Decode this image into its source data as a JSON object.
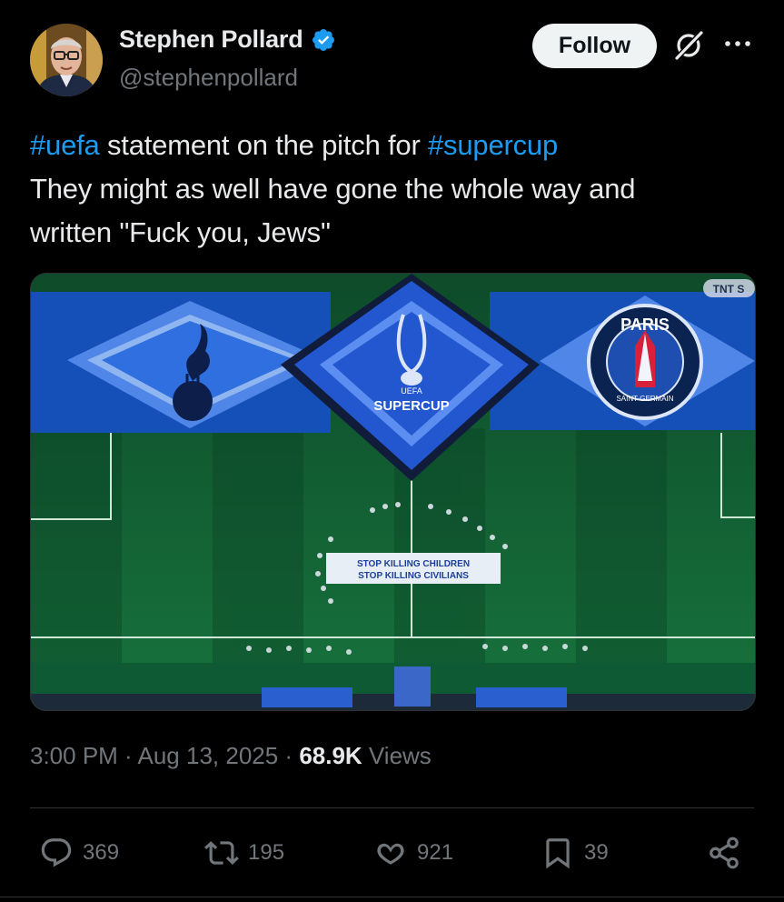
{
  "author": {
    "display_name": "Stephen Pollard",
    "handle": "@stephenpollard",
    "verified": true,
    "avatar_icon": "avatar-photo"
  },
  "follow_label": "Follow",
  "tweet": {
    "line1_hashtag1": "#uefa",
    "line1_text": " statement on the pitch for ",
    "line1_hashtag2": "#supercup",
    "line2": "They might as well have gone the whole way and",
    "line3": "written \"Fuck you, Jews\""
  },
  "media": {
    "banner_text_line1": "STOP KILLING CHILDREN",
    "banner_text_line2": "STOP KILLING CIVILIANS",
    "center_logo_text_small": "UEFA",
    "center_logo_text": "SUPERCUP",
    "right_logo_text": "PARIS",
    "right_logo_subtext": "SAINT-GERMAIN",
    "broadcaster_badge": "TNT S"
  },
  "meta": {
    "time": "3:00 PM",
    "sep1": " · ",
    "date": "Aug 13, 2025",
    "sep2": " · ",
    "views_count": "68.9K",
    "views_label": " Views"
  },
  "actions": {
    "replies": "369",
    "reposts": "195",
    "likes": "921",
    "bookmarks": "39"
  },
  "colors": {
    "background": "#000000",
    "link": "#1d9bf0",
    "secondary_text": "#71767b",
    "verified_badge": "#1d9bf0"
  }
}
